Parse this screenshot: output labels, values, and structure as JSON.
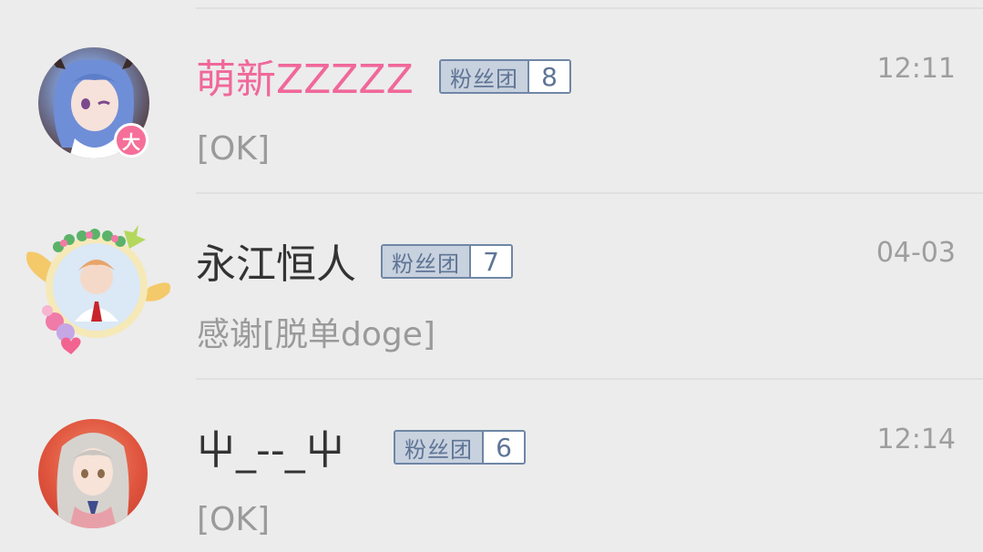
{
  "conversations": [
    {
      "name": "萌新ZZZZZ",
      "name_color": "#f0689a",
      "badge_label": "粉丝团",
      "badge_level": "8",
      "time": "12:11",
      "message": "[OK]",
      "avatar_tag": "大"
    },
    {
      "name": "永江恒人",
      "name_color": "#333333",
      "badge_label": "粉丝团",
      "badge_level": "7",
      "time": "04-03",
      "message": "感谢[脱单doge]"
    },
    {
      "name": "屮_--_屮",
      "name_color": "#333333",
      "badge_label": "粉丝团",
      "badge_level": "6",
      "time": "12:14",
      "message": "[OK]"
    }
  ],
  "colors": {
    "background": "#ececec",
    "badge_border": "#6f86a6",
    "badge_fill": "#c8d1de",
    "vip_pink": "#f56f99"
  }
}
